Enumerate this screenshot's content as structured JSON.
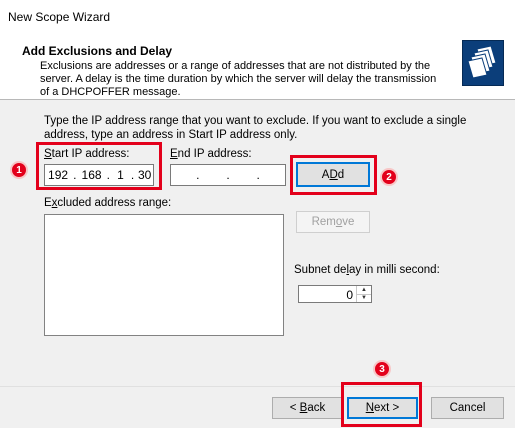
{
  "window": {
    "title": "New Scope Wizard"
  },
  "header": {
    "title": "Add Exclusions and Delay",
    "description": "Exclusions are addresses or a range of addresses that are not distributed by the server. A delay is the time duration by which the server will delay the transmission of a DHCPOFFER message."
  },
  "form": {
    "instruction": "Type the IP address range that you want to exclude. If you want to exclude a single address, type an address in Start IP address only.",
    "start_ip": {
      "label_underlined": "S",
      "label_rest": "tart IP address:",
      "octets": [
        "192",
        "168",
        "1",
        "30"
      ]
    },
    "end_ip": {
      "label_underlined": "E",
      "label_rest": "nd IP address:",
      "octets": [
        "",
        "",
        "",
        ""
      ]
    },
    "add_button": {
      "label_underlined": "D",
      "label_pre": "A",
      "label_post": "d"
    },
    "excluded": {
      "label_pre": "E",
      "label_underlined": "x",
      "label_post": "cluded address range:"
    },
    "remove_button": {
      "label_pre": "Rem",
      "label_underlined": "o",
      "label_post": "ve"
    },
    "delay": {
      "label_pre": "Subnet de",
      "label_underlined": "l",
      "label_post": "ay in milli second:",
      "value": "0"
    }
  },
  "footer": {
    "back": {
      "label_pre": "< ",
      "label_underlined": "B",
      "label_post": "ack"
    },
    "next": {
      "label_underlined": "N",
      "label_post": "ext >"
    },
    "cancel": "Cancel"
  },
  "annotations": {
    "step1": "1",
    "step2": "2",
    "step3": "3",
    "color": "#e3001b"
  }
}
